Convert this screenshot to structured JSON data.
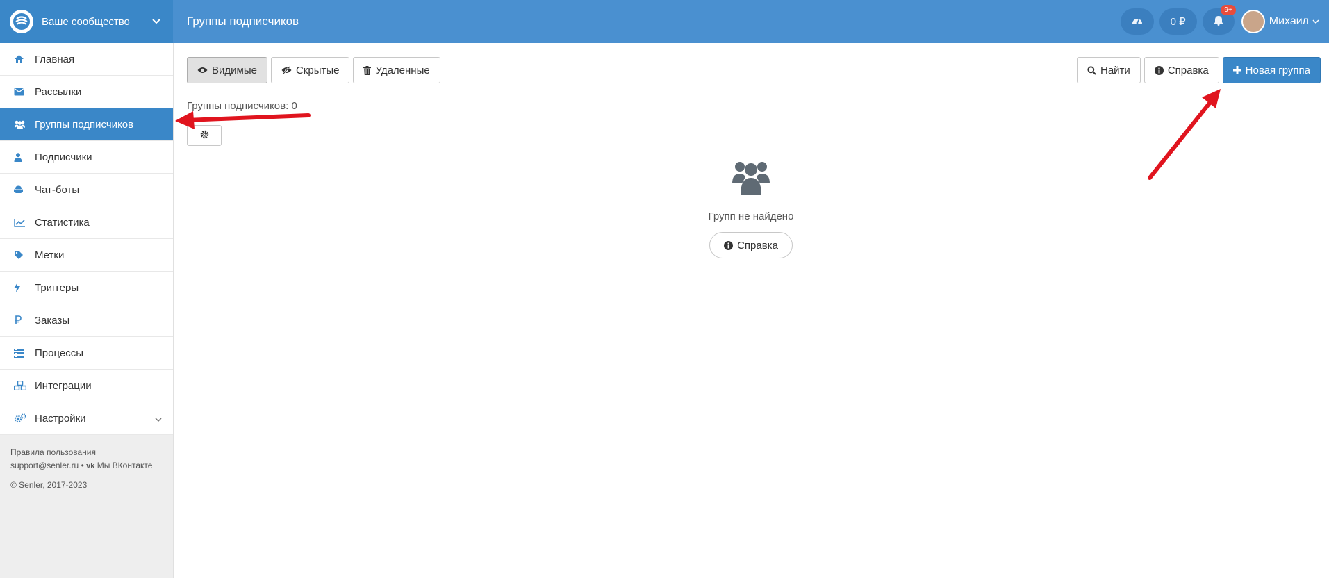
{
  "app": {
    "community_name": "Ваше сообщество",
    "page_title": "Группы подписчиков"
  },
  "topbar": {
    "balance": "0 ₽",
    "notifications_badge": "9+",
    "user_name": "Михаил"
  },
  "sidebar": {
    "items": [
      {
        "label": "Главная",
        "icon": "home-icon"
      },
      {
        "label": "Рассылки",
        "icon": "envelope-icon"
      },
      {
        "label": "Группы подписчиков",
        "icon": "users-icon"
      },
      {
        "label": "Подписчики",
        "icon": "user-icon"
      },
      {
        "label": "Чат-боты",
        "icon": "android-icon"
      },
      {
        "label": "Статистика",
        "icon": "line-chart-icon"
      },
      {
        "label": "Метки",
        "icon": "tag-icon"
      },
      {
        "label": "Триггеры",
        "icon": "bolt-icon"
      },
      {
        "label": "Заказы",
        "icon": "ruble-icon"
      },
      {
        "label": "Процессы",
        "icon": "list-icon"
      },
      {
        "label": "Интеграции",
        "icon": "cubes-icon"
      },
      {
        "label": "Настройки",
        "icon": "cogs-icon"
      }
    ],
    "footer": {
      "terms": "Правила пользования",
      "email": "support@senler.ru",
      "separator": "•",
      "vk": "Мы ВКонтакте",
      "copyright": "© Senler, 2017-2023"
    }
  },
  "main": {
    "tabs": [
      "Видимые",
      "Скрытые",
      "Удаленные"
    ],
    "find_label": "Найти",
    "help_label": "Справка",
    "new_group_label": "Новая группа",
    "groups_count": "Группы подписчиков: 0",
    "empty_message": "Групп не найдено",
    "empty_help_label": "Справка"
  },
  "colors": {
    "accent": "#3a87c8",
    "topbar": "#4a90d0",
    "annotation_arrow": "#e0141e"
  }
}
